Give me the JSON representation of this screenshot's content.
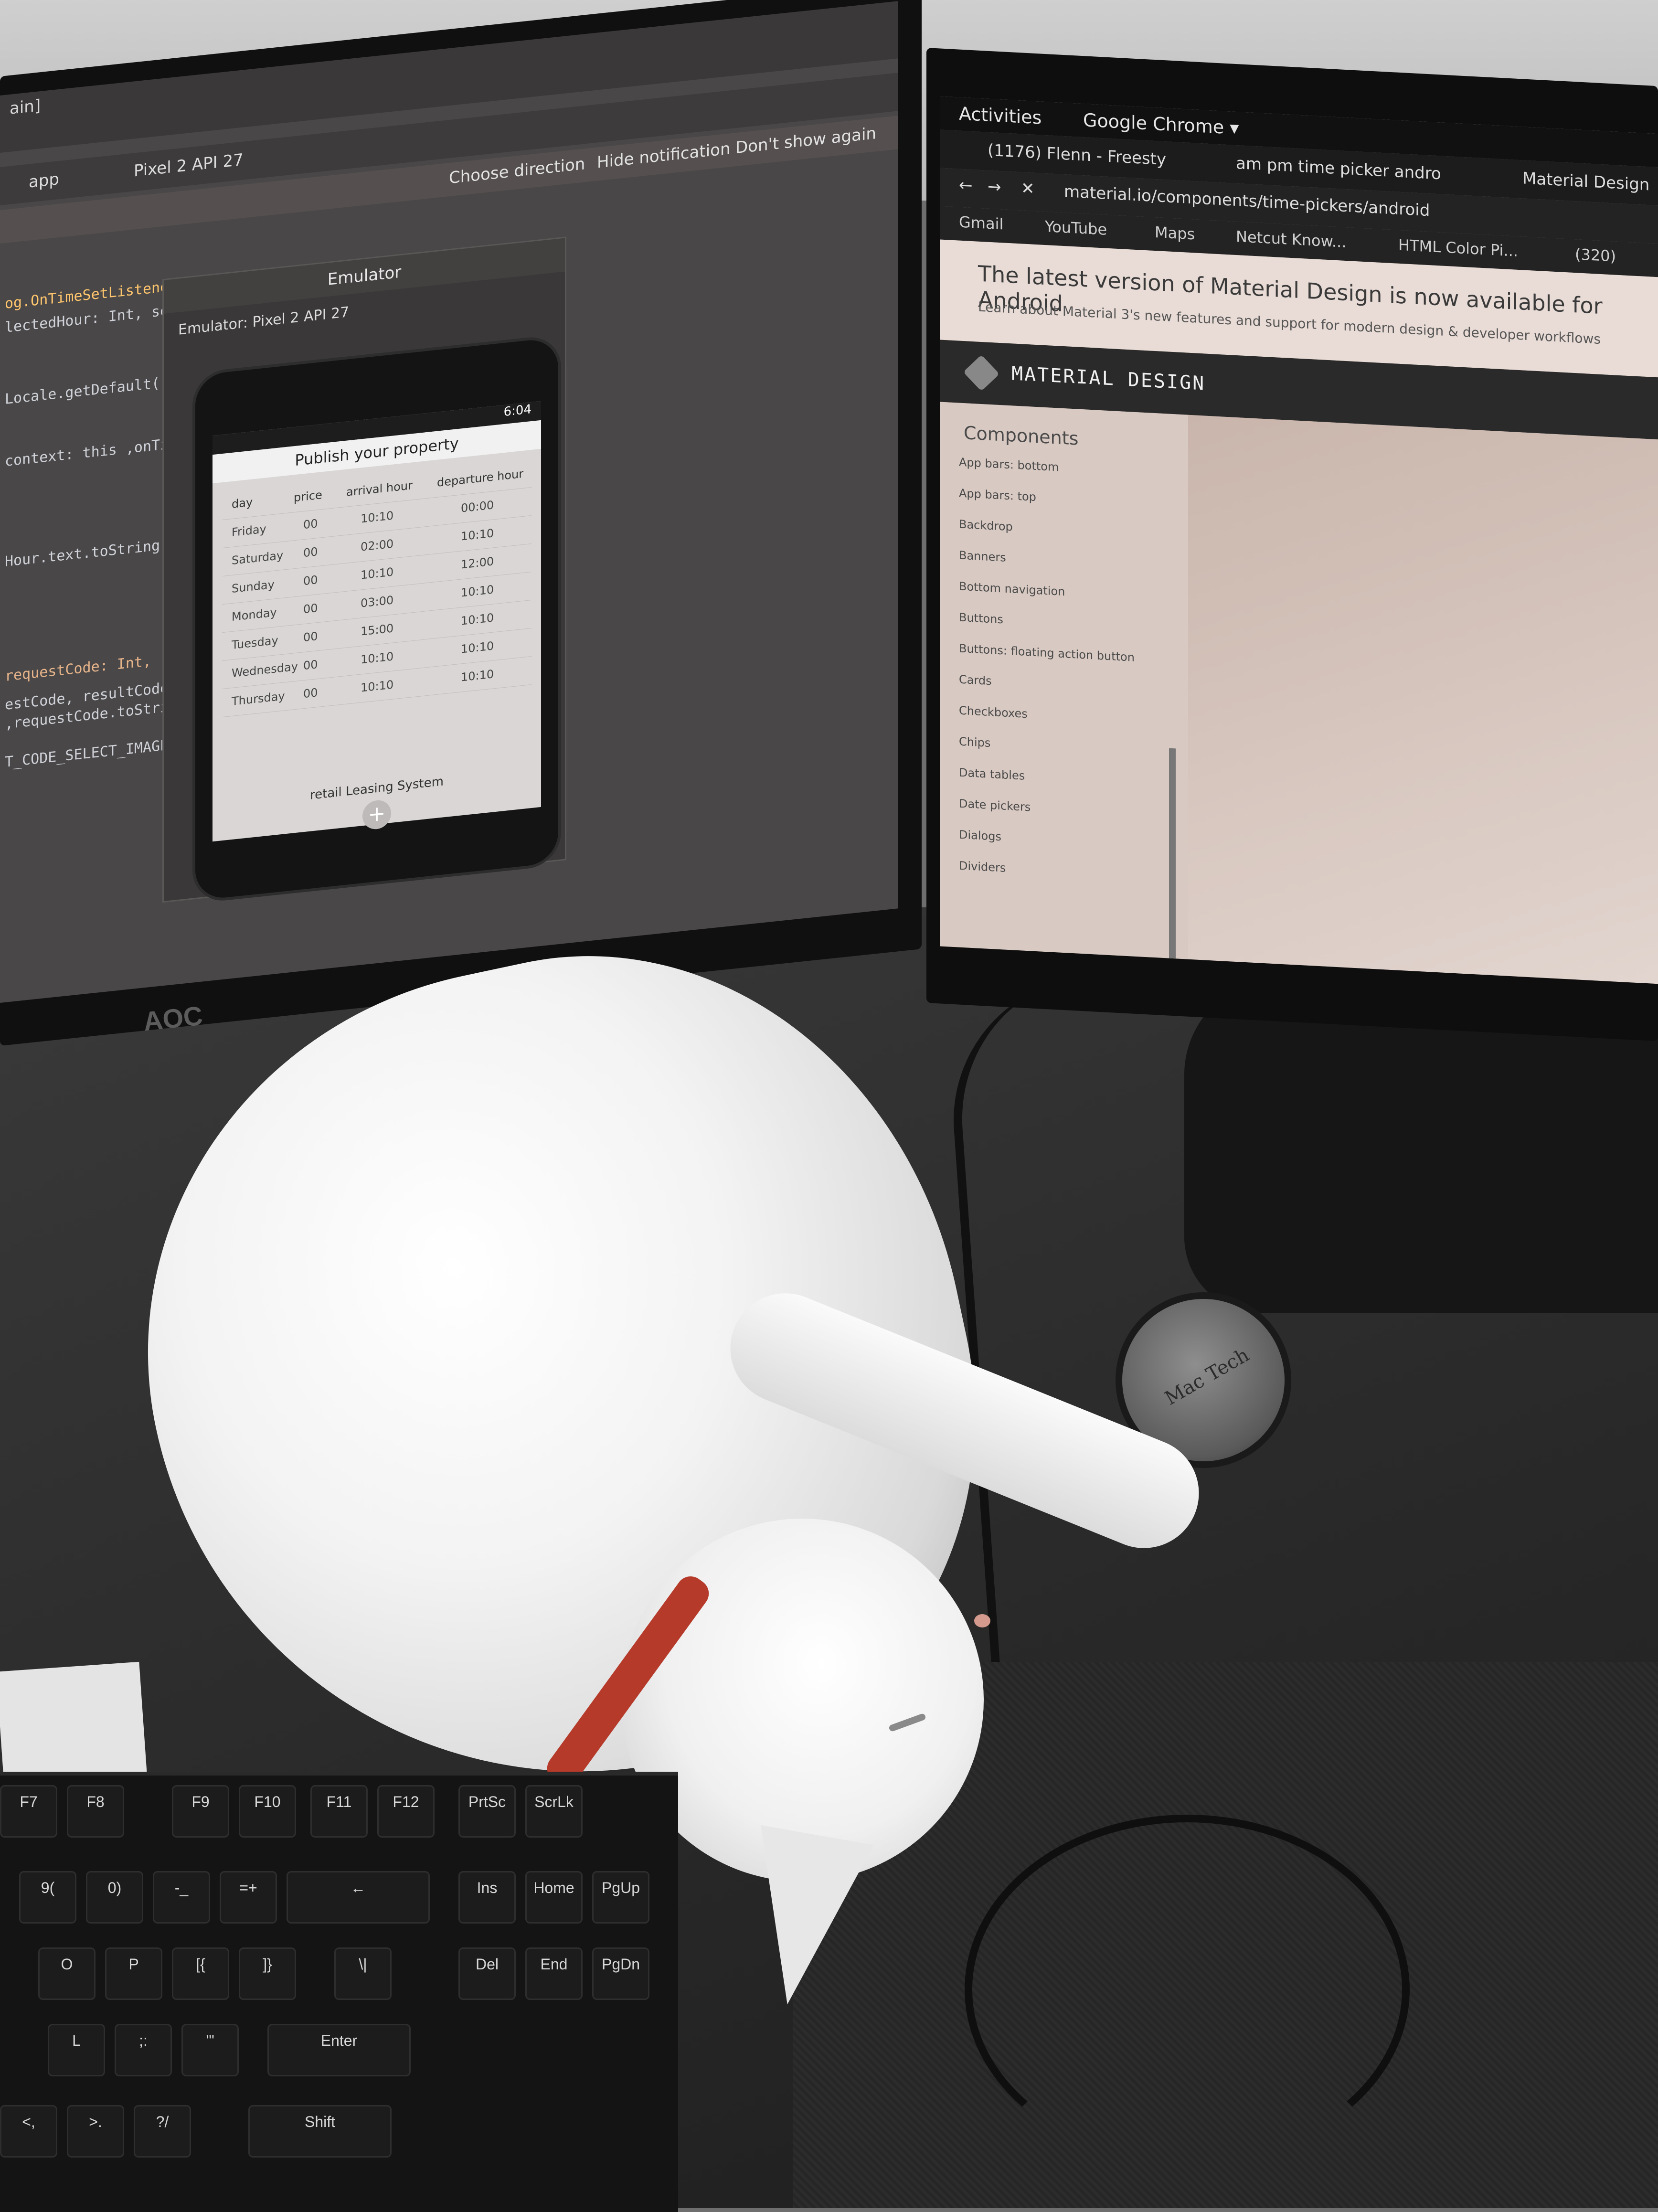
{
  "left_monitor": {
    "brand": "AOC",
    "ide": {
      "window_title": "ain]",
      "toolbar": {
        "module": "app",
        "device": "Pixel 2 API 27"
      },
      "notification": {
        "choose": "Choose direction",
        "hide": "Hide notification",
        "dont_show": "Don't show again"
      },
      "code_lines": [
        "og.OnTimeSetListener(",
        "lectedHour: Int, selectedMi",
        "Locale.getDefault() ,format:",
        "context: this ,onTimeSetListener",
        "Hour.text.toString() ,arrivalHour.text.to",
        "requestCode: Int, resultCode: Int, data: Intent?) {",
        "estCode, resultCode, data)",
        ",requestCode.toString() ,Toast.LENGTH_LONG).show()",
        "T_CODE_SELECT_IMAGES && resultCode == RESULT_OK && null"
      ]
    },
    "emulator": {
      "title": "Emulator",
      "tab": "Emulator:  Pixel 2 API 27",
      "phone": {
        "status_time": "6:04",
        "app_title": "Publish your property",
        "table_headers": [
          "day",
          "price",
          "arrival hour",
          "departure hour"
        ],
        "rows": [
          [
            "Friday",
            "00",
            "10:10",
            "00:00"
          ],
          [
            "Saturday",
            "00",
            "02:00",
            "10:10"
          ],
          [
            "Sunday",
            "00",
            "10:10",
            "12:00"
          ],
          [
            "Monday",
            "00",
            "03:00",
            "10:10"
          ],
          [
            "Tuesday",
            "00",
            "15:00",
            "10:10"
          ],
          [
            "Wednesday",
            "00",
            "10:10",
            "10:10"
          ],
          [
            "Thursday",
            "00",
            "10:10",
            "10:10"
          ]
        ],
        "footer": "retail Leasing System",
        "fab": "+"
      }
    }
  },
  "right_monitor": {
    "gnome": {
      "activities": "Activities",
      "app": "Google Chrome ▾"
    },
    "tabs": [
      "(1176) Flenn - Freesty",
      "am pm time picker andro",
      "Material Design"
    ],
    "url": "material.io/components/time-pickers/android",
    "bookmarks": [
      "Gmail",
      "YouTube",
      "Maps",
      "Netcut Know...",
      "HTML Color Pi...",
      "(320)"
    ],
    "banner": {
      "title": "The latest version of Material Design is now available for Android",
      "subtitle": "Learn about Material 3's new features and support for modern design & developer workflows"
    },
    "site_name": "MATERIAL DESIGN",
    "sidebar": {
      "heading": "Components",
      "items": [
        "App bars: bottom",
        "App bars: top",
        "Backdrop",
        "Banners",
        "Bottom navigation",
        "Buttons",
        "Buttons: floating action button",
        "Cards",
        "Checkboxes",
        "Chips",
        "Data tables",
        "Date pickers",
        "Dialogs",
        "Dividers"
      ]
    }
  },
  "desk": {
    "coaster_label": "Mac Tech",
    "keyboard_keys": [
      "F7",
      "F8",
      "F9",
      "F10",
      "F11",
      "F12",
      "PrtSc",
      "ScrLk",
      "9(",
      "0)",
      "-_",
      "=+",
      "←",
      "Ins",
      "Home",
      "PgUp",
      "O",
      "P",
      "[{",
      "]}",
      "\\|",
      "Del",
      "End",
      "PgDn",
      "L",
      ";:",
      "'\"",
      "Enter",
      "<,",
      ">.",
      "?/",
      "Shift"
    ]
  }
}
